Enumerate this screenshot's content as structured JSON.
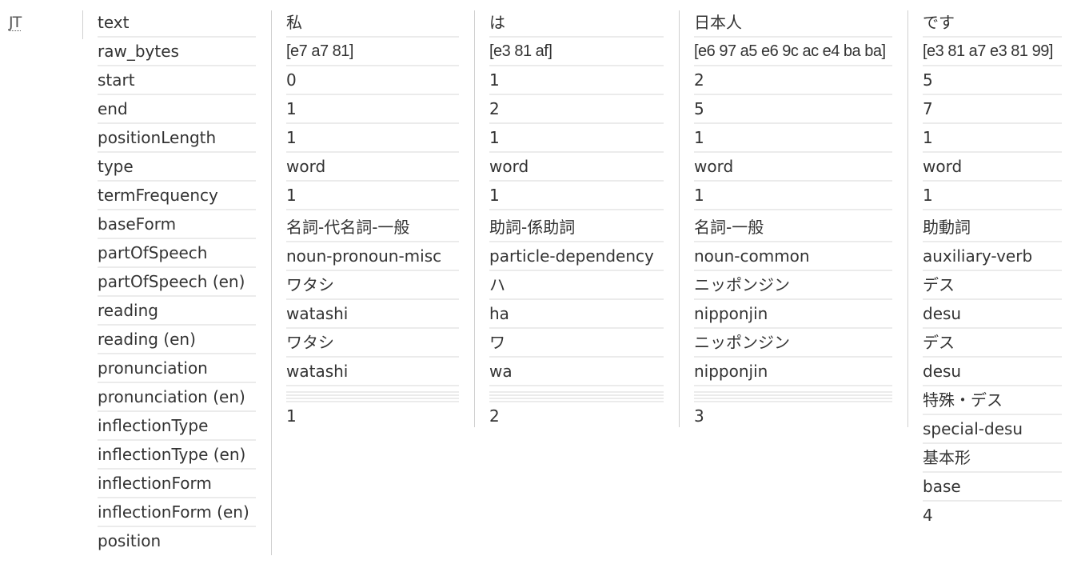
{
  "stage_label": "JT",
  "labels": [
    "text",
    "raw_bytes",
    "start",
    "end",
    "positionLength",
    "type",
    "termFrequency",
    "baseForm",
    "partOfSpeech",
    "partOfSpeech (en)",
    "reading",
    "reading (en)",
    "pronunciation",
    "pronunciation (en)",
    "inflectionType",
    "inflectionType (en)",
    "inflectionForm",
    "inflectionForm (en)",
    "position"
  ],
  "tokens": [
    {
      "text": "私",
      "raw_bytes": "[e7 a7 81]",
      "start": "0",
      "end": "1",
      "positionLength": "1",
      "type": "word",
      "termFrequency": "1",
      "baseForm": "名詞-代名詞-一般",
      "partOfSpeech": "noun-pronoun-misc",
      "partOfSpeech_en": "ワタシ",
      "reading": "watashi",
      "reading_en": "ワタシ",
      "pronunciation": "watashi",
      "position": "1"
    },
    {
      "text": "は",
      "raw_bytes": "[e3 81 af]",
      "start": "1",
      "end": "2",
      "positionLength": "1",
      "type": "word",
      "termFrequency": "1",
      "baseForm": "助詞-係助詞",
      "partOfSpeech": "particle-dependency",
      "partOfSpeech_en": "ハ",
      "reading": "ha",
      "reading_en": "ワ",
      "pronunciation": "wa",
      "position": "2"
    },
    {
      "text": "日本人",
      "raw_bytes": "[e6 97 a5 e6 9c ac e4 ba ba]",
      "start": "2",
      "end": "5",
      "positionLength": "1",
      "type": "word",
      "termFrequency": "1",
      "baseForm": "名詞-一般",
      "partOfSpeech": "noun-common",
      "partOfSpeech_en": "ニッポンジン",
      "reading": "nipponjin",
      "reading_en": "ニッポンジン",
      "pronunciation": "nipponjin",
      "position": "3"
    },
    {
      "text": "です",
      "raw_bytes": "[e3 81 a7 e3 81 99]",
      "start": "5",
      "end": "7",
      "positionLength": "1",
      "type": "word",
      "termFrequency": "1",
      "baseForm": "助動詞",
      "partOfSpeech": "auxiliary-verb",
      "partOfSpeech_en": "デス",
      "reading": "desu",
      "reading_en": "デス",
      "pronunciation": "desu",
      "pronunciation_en": "特殊・デス",
      "inflectionType": "special-desu",
      "inflectionType_en": "基本形",
      "inflectionForm": "base",
      "position": "4"
    }
  ]
}
